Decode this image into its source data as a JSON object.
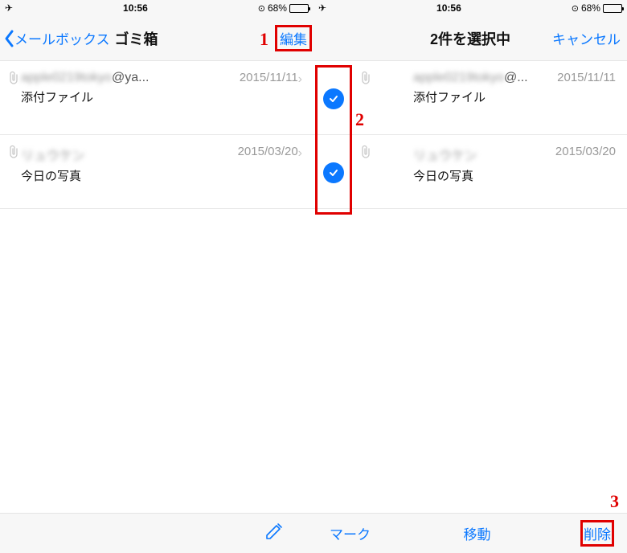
{
  "statusbar": {
    "time": "10:56",
    "battery_pct": "68%"
  },
  "left": {
    "back_label": "メールボックス",
    "title": "ゴミ箱",
    "edit_label": "編集",
    "rows": [
      {
        "sender_blur": "apple0219tokyo",
        "sender_tail": "@ya...",
        "date": "2015/11/11",
        "subject": "添付ファイル"
      },
      {
        "sender_blur": "リュウケン",
        "sender_tail": "",
        "date": "2015/03/20",
        "subject": "今日の写真"
      }
    ]
  },
  "right": {
    "title": "2件を選択中",
    "cancel_label": "キャンセル",
    "rows": [
      {
        "sender_blur": "apple0219tokyo",
        "sender_tail": "@...",
        "date": "2015/11/11",
        "subject": "添付ファイル",
        "checked": true
      },
      {
        "sender_blur": "リュウケン",
        "sender_tail": "",
        "date": "2015/03/20",
        "subject": "今日の写真",
        "checked": true
      }
    ],
    "mark_label": "マーク",
    "move_label": "移動",
    "delete_label": "削除"
  },
  "callouts": {
    "n1": "1",
    "n2": "2",
    "n3": "3"
  }
}
